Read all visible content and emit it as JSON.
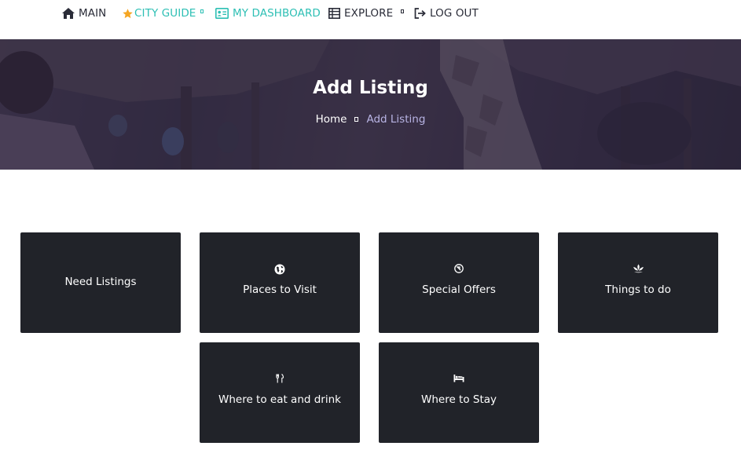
{
  "nav": {
    "main": {
      "label": "MAIN",
      "icon": "home-icon"
    },
    "city_guide": {
      "label": "CITY GUIDE",
      "icon": "star-icon",
      "color": "#2dbfb4"
    },
    "dashboard": {
      "label": "MY DASHBOARD",
      "icon": "id-card-icon",
      "color": "#2dbfb4"
    },
    "explore": {
      "label": "EXPLORE",
      "icon": "table-icon"
    },
    "logout": {
      "label": "LOG OUT",
      "icon": "logout-icon"
    }
  },
  "hero": {
    "title": "Add Listing",
    "breadcrumb": {
      "home": "Home",
      "current": "Add Listing"
    }
  },
  "cards": [
    {
      "label": "Need Listings",
      "icon": ""
    },
    {
      "label": "Places to Visit",
      "icon": "globe-icon"
    },
    {
      "label": "Special Offers",
      "icon": "offer-icon"
    },
    {
      "label": "Things to do",
      "icon": "lotus-icon"
    },
    {
      "label": "Where to eat and drink",
      "icon": "utensils-icon"
    },
    {
      "label": "Where to Stay",
      "icon": "bed-icon"
    }
  ],
  "colors": {
    "accent": "#2dbfb4",
    "card_bg": "#212329",
    "hero_overlay": "#2a223e",
    "breadcrumb_current": "#b8b4e4"
  }
}
